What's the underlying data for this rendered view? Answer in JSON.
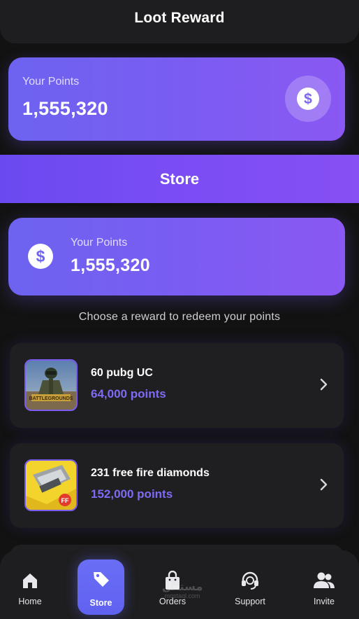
{
  "header": {
    "title": "Loot Reward"
  },
  "points_card": {
    "label": "Your Points",
    "value": "1,555,320",
    "icon": "dollar-coin-icon"
  },
  "store": {
    "title": "Store",
    "points_label": "Your Points",
    "points_value": "1,555,320",
    "prompt": "Choose a reward to redeem your points"
  },
  "rewards": [
    {
      "name": "60 pubg UC",
      "points": "64,000 points",
      "thumbnail": "pubg-battlegrounds-thumbnail"
    },
    {
      "name": "231 free fire diamonds",
      "points": "152,000 points",
      "thumbnail": "free-fire-thumbnail"
    }
  ],
  "nav": {
    "items": [
      {
        "label": "Home",
        "icon": "home-icon",
        "active": false
      },
      {
        "label": "Store",
        "icon": "tag-icon",
        "active": true
      },
      {
        "label": "Orders",
        "icon": "shopping-bag-icon",
        "active": false
      },
      {
        "label": "Support",
        "icon": "headset-icon",
        "active": false
      },
      {
        "label": "Invite",
        "icon": "people-icon",
        "active": false
      }
    ]
  },
  "watermark": {
    "main": "مستقل",
    "sub": "mostaql.com"
  },
  "colors": {
    "accent": "#7b5cf2",
    "points_text": "#7d6cf3",
    "background": "#121212",
    "card": "#1f1f22"
  }
}
